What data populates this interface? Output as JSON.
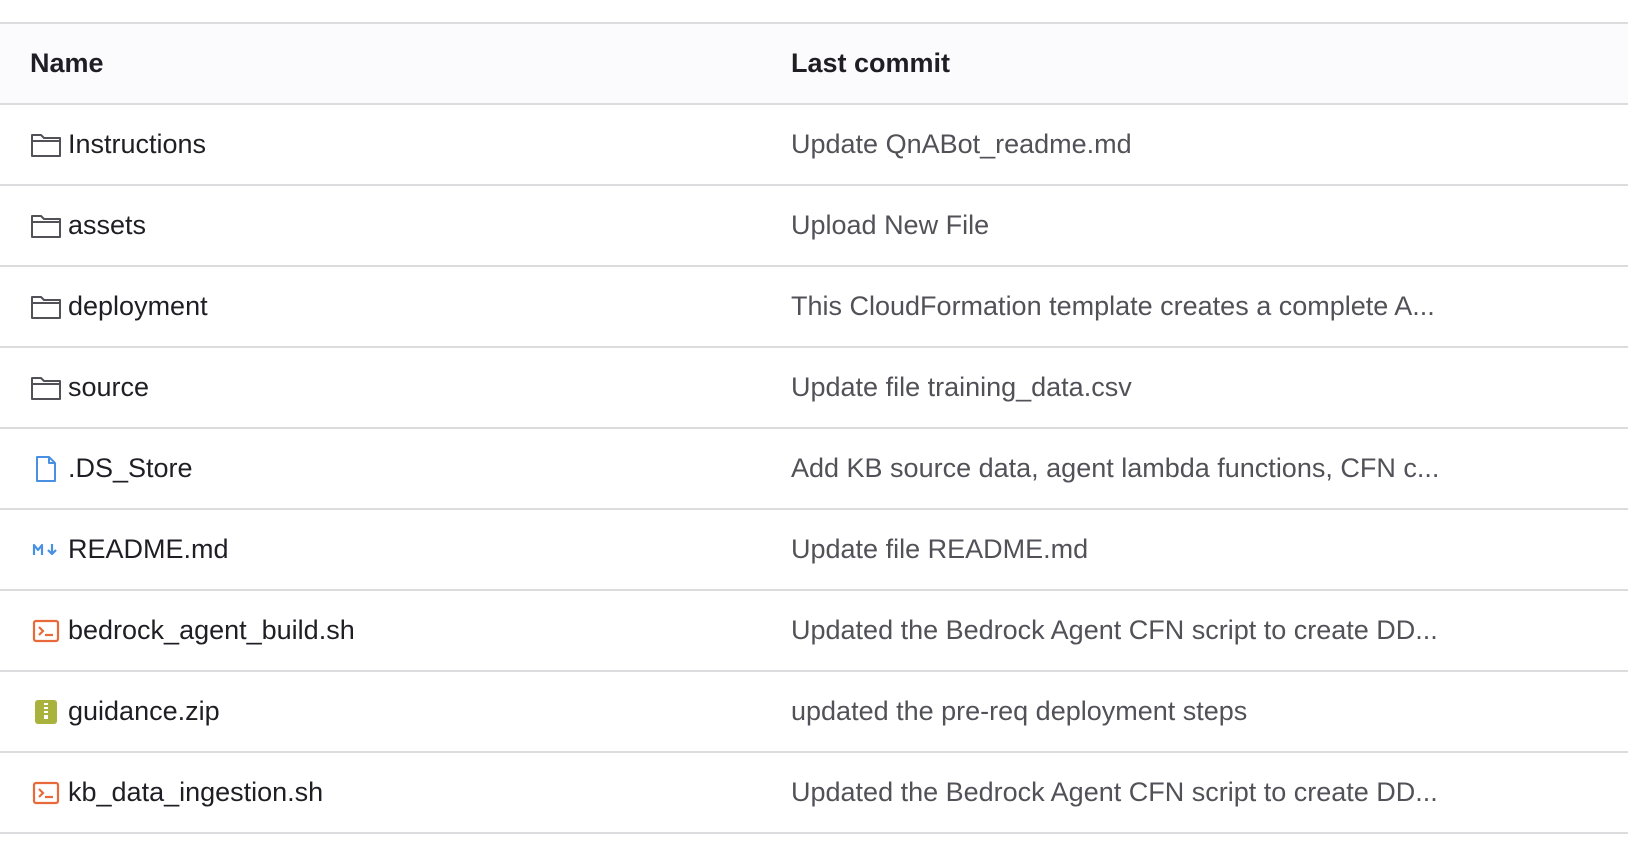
{
  "table": {
    "headers": {
      "name": "Name",
      "last_commit": "Last commit"
    },
    "rows": [
      {
        "name": "Instructions",
        "icon": "folder-icon",
        "commit": "Update QnABot_readme.md"
      },
      {
        "name": "assets",
        "icon": "folder-icon",
        "commit": "Upload New File"
      },
      {
        "name": "deployment",
        "icon": "folder-icon",
        "commit": "This CloudFormation template creates a complete A..."
      },
      {
        "name": "source",
        "icon": "folder-icon",
        "commit": "Update file training_data.csv"
      },
      {
        "name": ".DS_Store",
        "icon": "file-icon",
        "commit": "Add KB source data, agent lambda functions, CFN c..."
      },
      {
        "name": "README.md",
        "icon": "markdown-icon",
        "commit": "Update file README.md"
      },
      {
        "name": "bedrock_agent_build.sh",
        "icon": "terminal-icon",
        "commit": "Updated the Bedrock Agent CFN script to create DD..."
      },
      {
        "name": "guidance.zip",
        "icon": "archive-icon",
        "commit": "updated the pre-req deployment steps"
      },
      {
        "name": "kb_data_ingestion.sh",
        "icon": "terminal-icon",
        "commit": "Updated the Bedrock Agent CFN script to create DD..."
      }
    ]
  },
  "colors": {
    "folder": "#535158",
    "file": "#4a90e2",
    "markdown": "#4a90e2",
    "terminal": "#e86a3a",
    "archive": "#a8b23c",
    "border": "#dcdcde",
    "header_bg": "#fbfafd"
  }
}
